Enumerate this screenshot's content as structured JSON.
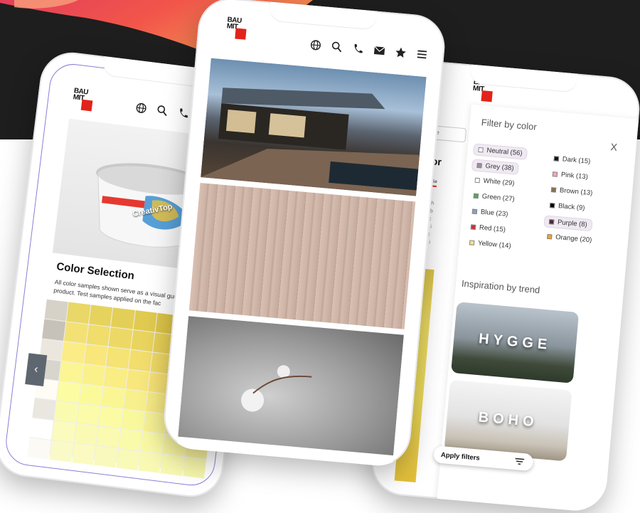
{
  "brand": {
    "logo_text": "BAU\nMIT",
    "accent": "#e2231a"
  },
  "header_icons": [
    "globe-icon",
    "search-icon",
    "phone-icon",
    "mail-icon",
    "star-icon",
    "menu-icon"
  ],
  "phone1": {
    "title": "Color Selection",
    "description": "All color samples shown serve as a visual guide chosen product. Test samples applied on the fac",
    "product_label": "CreativTop",
    "nav_prev_glyph": "‹"
  },
  "phone3": {
    "search_placeholder": "Type",
    "heading_peek": "Wor",
    "tab_peek": "Color Se",
    "text_peek": "Find th\ntext ab\nperfec\nabout i\nperfec\nabout i",
    "filter": {
      "title": "Filter by color",
      "close": "X",
      "chips": [
        {
          "label": "Neutral (56)",
          "color": "#ffffff",
          "selected": true
        },
        {
          "label": "Dark (15)",
          "color": "#111111",
          "selected": false
        },
        {
          "label": "Grey (38)",
          "color": "#9a8f96",
          "selected": true
        },
        {
          "label": "Pink (13)",
          "color": "#f3a7b5",
          "selected": false
        },
        {
          "label": "White (29)",
          "color": "#ffffff",
          "selected": false
        },
        {
          "label": "Brown (13)",
          "color": "#8a6e52",
          "selected": false
        },
        {
          "label": "Green (27)",
          "color": "#5aa55a",
          "selected": false
        },
        {
          "label": "Black (9)",
          "color": "#000000",
          "selected": false
        },
        {
          "label": "Blue (23)",
          "color": "#8aa0c0",
          "selected": false
        },
        {
          "label": "Purple (8)",
          "color": "#4a2a3a",
          "selected": true
        },
        {
          "label": "Red (15)",
          "color": "#c8323c",
          "selected": false
        },
        {
          "label": "Orange (20)",
          "color": "#f0a030",
          "selected": false
        },
        {
          "label": "Yellow (14)",
          "color": "#f2e08a",
          "selected": false
        }
      ]
    },
    "trend_title": "Inspiration by trend",
    "trends": [
      "HYGGE",
      "BOHO"
    ],
    "apply_label": "Apply filters"
  }
}
